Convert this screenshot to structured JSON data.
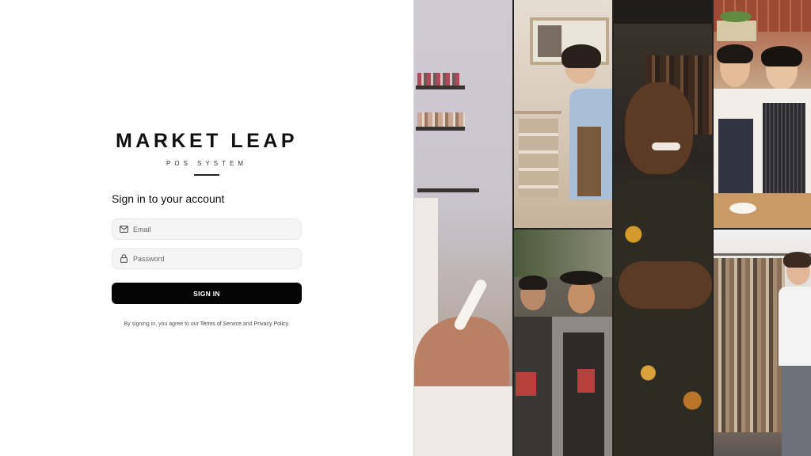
{
  "brand": {
    "name": "MARKET LEAP",
    "subtitle": "POS SYSTEM"
  },
  "form": {
    "heading": "Sign in to your account",
    "email": {
      "placeholder": "Email",
      "value": "",
      "icon": "mail-icon"
    },
    "password": {
      "placeholder": "Password",
      "value": "",
      "icon": "lock-icon"
    },
    "submit_label": "SIGN IN"
  },
  "legal": {
    "prefix": "By signing in, you agree to our ",
    "terms_label": "Terms of Service",
    "middle": " and ",
    "privacy_label": "Privacy Policy",
    "suffix": "."
  },
  "colors": {
    "button_bg": "#050505",
    "field_bg": "#f5f5f5",
    "page_bg": "#ffffff"
  }
}
